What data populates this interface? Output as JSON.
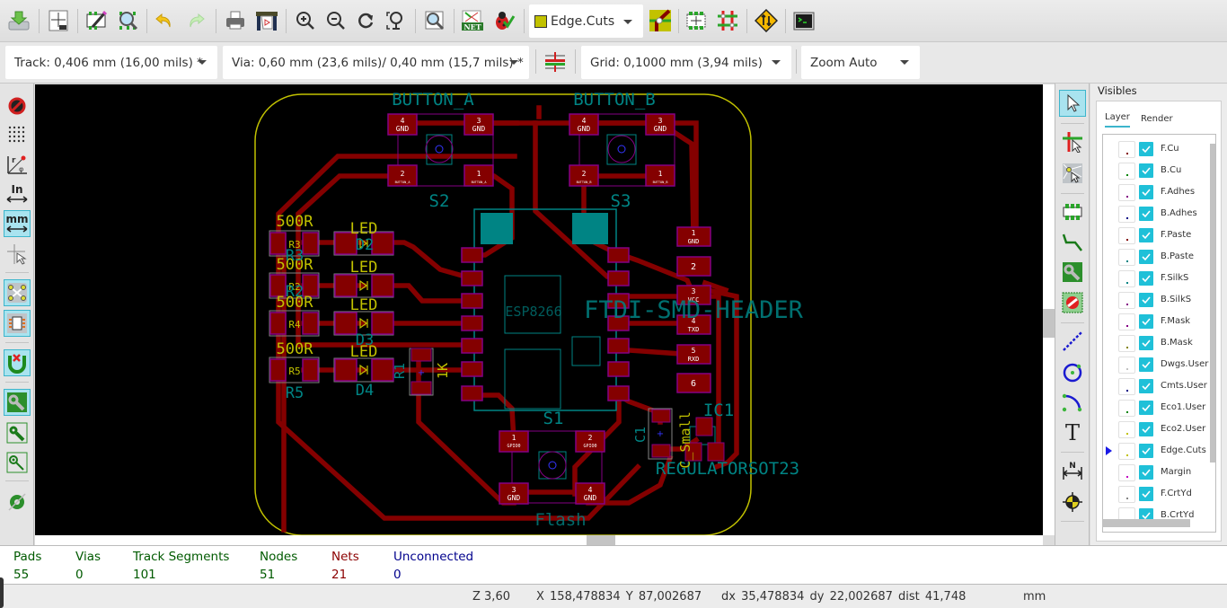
{
  "toolbar_main": {
    "buttons": [
      {
        "name": "save-board",
        "icon": "save-icon"
      },
      {
        "name": "page-settings",
        "icon": "page-settings-icon"
      },
      {
        "name": "footprint-editor",
        "icon": "footprint-editor-icon"
      },
      {
        "name": "footprint-viewer",
        "icon": "footprint-viewer-icon"
      },
      {
        "name": "undo",
        "icon": "undo-icon"
      },
      {
        "name": "redo",
        "icon": "redo-icon"
      },
      {
        "name": "print",
        "icon": "print-icon"
      },
      {
        "name": "plot",
        "icon": "plotter-icon"
      },
      {
        "name": "zoom-in",
        "icon": "zoom-in-icon"
      },
      {
        "name": "zoom-out",
        "icon": "zoom-out-icon"
      },
      {
        "name": "redraw",
        "icon": "redraw-icon"
      },
      {
        "name": "zoom-fit",
        "icon": "zoom-fit-icon"
      },
      {
        "name": "find",
        "icon": "find-icon"
      },
      {
        "name": "read-netlist",
        "icon": "netlist-icon"
      },
      {
        "name": "drc",
        "icon": "drc-icon"
      },
      {
        "name": "layer-pair",
        "icon": "layer-pair-icon"
      },
      {
        "name": "footprint-mode",
        "icon": "footprint-mode-icon"
      },
      {
        "name": "track-mode",
        "icon": "track-mode-icon"
      },
      {
        "name": "backannotate",
        "icon": "backannotate-icon"
      },
      {
        "name": "scripting-console",
        "icon": "terminal-icon"
      }
    ],
    "active_layer": {
      "label": "Edge.Cuts",
      "color": "#c2c200"
    }
  },
  "toolbar_aux": {
    "track_width": "Track: 0,406 mm (16,00 mils) *",
    "via_size": "Via: 0,60 mm (23,6 mils)/ 0,40 mm (15,7 mils) *",
    "grid": "Grid: 0,1000 mm (3,94 mils)",
    "zoom": "Zoom Auto"
  },
  "left_toolbar": [
    {
      "name": "drc-off",
      "icon": "drc-off-icon",
      "active": false
    },
    {
      "name": "show-grid",
      "icon": "grid-icon",
      "active": false
    },
    {
      "name": "polar-coords",
      "icon": "polar-coords-icon",
      "active": false
    },
    {
      "name": "units-inch",
      "icon": "inch-units-icon",
      "active": false
    },
    {
      "name": "units-mm",
      "icon": "mm-units-icon",
      "active": true
    },
    {
      "name": "cursor-shape",
      "icon": "full-cursor-icon",
      "active": false
    },
    {
      "name": "show-ratsnest",
      "icon": "ratsnest-icon",
      "active": true
    },
    {
      "name": "module-ratsnest",
      "icon": "module-ratsnest-icon",
      "active": true
    },
    {
      "name": "auto-delete-track",
      "icon": "auto-delete-track-icon",
      "active": true
    },
    {
      "name": "zone-fill",
      "icon": "zone-fill-icon",
      "active": true
    },
    {
      "name": "zone-unfill",
      "icon": "zone-unfill-icon",
      "active": false
    },
    {
      "name": "zone-outline",
      "icon": "zone-outline-icon",
      "active": false
    },
    {
      "name": "pad-sketch",
      "icon": "pad-sketch-icon",
      "active": false
    }
  ],
  "right_toolbar": [
    {
      "name": "select",
      "icon": "cursor-icon",
      "active": true
    },
    {
      "name": "highlight-net",
      "icon": "highlight-net-icon",
      "active": false
    },
    {
      "name": "local-ratsnest",
      "icon": "local-ratsnest-icon",
      "active": false
    },
    {
      "name": "add-footprint",
      "icon": "footprint-icon",
      "active": false
    },
    {
      "name": "route-track",
      "icon": "track-icon",
      "active": false
    },
    {
      "name": "add-zone",
      "icon": "zone-icon",
      "active": false
    },
    {
      "name": "add-keepout",
      "icon": "keepout-icon",
      "active": false
    },
    {
      "name": "add-line",
      "icon": "line-icon",
      "active": false
    },
    {
      "name": "add-circle",
      "icon": "circle-icon",
      "active": false
    },
    {
      "name": "add-arc",
      "icon": "arc-icon",
      "active": false
    },
    {
      "name": "add-text",
      "icon": "text-icon",
      "active": false
    },
    {
      "name": "add-dimension",
      "icon": "dimension-icon",
      "active": false
    },
    {
      "name": "add-target",
      "icon": "target-icon",
      "active": false
    }
  ],
  "layers_manager": {
    "title": "Visibles",
    "tabs": [
      "Layer",
      "Render"
    ],
    "active_tab": "Layer",
    "layers": [
      {
        "name": "F.Cu",
        "color": "#840000",
        "visible": true,
        "active": false
      },
      {
        "name": "B.Cu",
        "color": "#008400",
        "visible": true,
        "active": false
      },
      {
        "name": "F.Adhes",
        "color": "#840084",
        "visible": true,
        "active": false
      },
      {
        "name": "B.Adhes",
        "color": "#000084",
        "visible": true,
        "active": false
      },
      {
        "name": "F.Paste",
        "color": "#840000",
        "visible": true,
        "active": false
      },
      {
        "name": "B.Paste",
        "color": "#008484",
        "visible": true,
        "active": false
      },
      {
        "name": "F.SilkS",
        "color": "#008484",
        "visible": true,
        "active": false
      },
      {
        "name": "B.SilkS",
        "color": "#840084",
        "visible": true,
        "active": false
      },
      {
        "name": "F.Mask",
        "color": "#840084",
        "visible": true,
        "active": false
      },
      {
        "name": "B.Mask",
        "color": "#848400",
        "visible": true,
        "active": false
      },
      {
        "name": "Dwgs.User",
        "color": "#c2c2c2",
        "visible": true,
        "active": false
      },
      {
        "name": "Cmts.User",
        "color": "#000084",
        "visible": true,
        "active": false
      },
      {
        "name": "Eco1.User",
        "color": "#008400",
        "visible": true,
        "active": false
      },
      {
        "name": "Eco2.User",
        "color": "#c2c200",
        "visible": true,
        "active": false
      },
      {
        "name": "Edge.Cuts",
        "color": "#c2c200",
        "visible": true,
        "active": true
      },
      {
        "name": "Margin",
        "color": "#c200c2",
        "visible": true,
        "active": false
      },
      {
        "name": "F.CrtYd",
        "color": "#848484",
        "visible": true,
        "active": false
      },
      {
        "name": "B.CrtYd",
        "color": "#c2c200",
        "visible": true,
        "active": false
      }
    ]
  },
  "board": {
    "labels": {
      "button_a": "BUTTON_A",
      "button_b": "BUTTON_B",
      "s2": "S2",
      "s3": "S3",
      "s1": "S1",
      "flash": "Flash",
      "ftdi": "FTDI-SMD-HEADER",
      "esp": "ESP8266",
      "regulator": "REGULATORSOT23",
      "ic1": "IC1",
      "c1": "C1",
      "c_small": "C_Small",
      "r1": "R1",
      "r1_value": "1K",
      "res_value": "500R",
      "led": "LED",
      "r3": "R3",
      "r2": "R2",
      "r4": "R4",
      "r5": "R5",
      "d1": "D1",
      "d2": "D2",
      "d3": "D3",
      "d4": "D4"
    },
    "button_pads": {
      "p1": "1",
      "p2": "2",
      "p3": "3",
      "p4": "4",
      "gnd": "GND",
      "btn_a_net": "BUTTON_A",
      "btn_b_net": "BUTTON_B",
      "gpio0": "GPIO0"
    },
    "header_pads": [
      {
        "num": "1",
        "net": "GND"
      },
      {
        "num": "2",
        "net": ""
      },
      {
        "num": "3",
        "net": "VCC"
      },
      {
        "num": "4",
        "net": "TXD"
      },
      {
        "num": "5",
        "net": "RXD"
      },
      {
        "num": "6",
        "net": ""
      }
    ],
    "colors": {
      "copper": "#840000",
      "mask": "#840084",
      "silk": "#008484",
      "edge": "#c2c200",
      "fab": "#c2c200"
    }
  },
  "stats": [
    {
      "label": "Pads",
      "value": "55",
      "color": "#005a00"
    },
    {
      "label": "Vias",
      "value": "0",
      "color": "#005a00"
    },
    {
      "label": "Track Segments",
      "value": "101",
      "color": "#005a00"
    },
    {
      "label": "Nodes",
      "value": "51",
      "color": "#005a00"
    },
    {
      "label": "Nets",
      "value": "21",
      "color": "#8c0000"
    },
    {
      "label": "Unconnected",
      "value": "0",
      "color": "#00008c"
    }
  ],
  "status": {
    "zoom": "Z 3,60",
    "xy": "X 158,478834  Y 87,002687",
    "delta": "dx 35,478834  dy 22,002687  dist 41,748",
    "units": "mm"
  }
}
